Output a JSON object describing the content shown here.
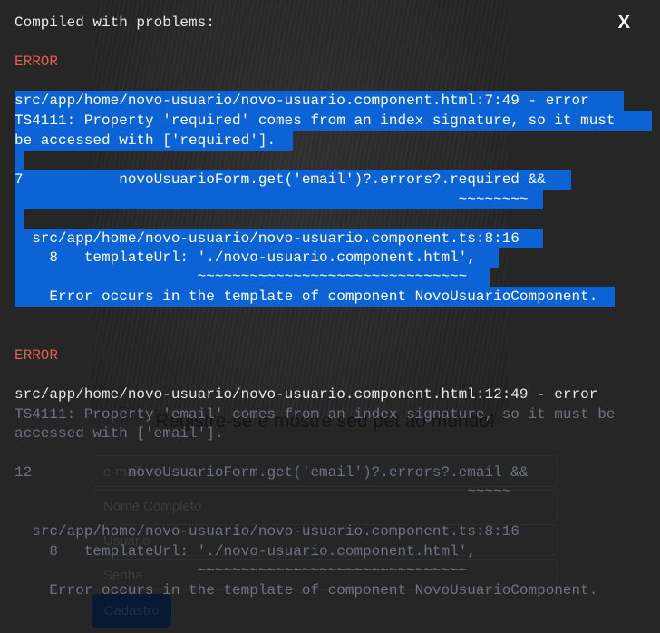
{
  "background_page": {
    "title": "Registre-se e mostre seu pet ao mundo!",
    "inputs": {
      "email": "e-mail",
      "full_name": "Nome Completo",
      "user": "Usuário",
      "password": "Senha"
    },
    "submit_label": "Cadastro"
  },
  "overlay": {
    "title": "Compiled with problems:",
    "close_label": "X",
    "errors": [
      {
        "label": "ERROR",
        "lines": [
          "src/app/home/novo-usuario/novo-usuario.component.html:7:49 - error",
          "TS4111: Property 'required' comes from an index signature, so it must",
          "be accessed with ['required'].",
          " ",
          "7           novoUsuarioForm.get('email')?.errors?.required &&",
          "                                                   ~~~~~~~~",
          " ",
          "  src/app/home/novo-usuario/novo-usuario.component.ts:8:16",
          "    8   templateUrl: './novo-usuario.component.html',",
          "                     ~~~~~~~~~~~~~~~~~~~~~~~~~~~~~~~",
          "    Error occurs in the template of component NovoUsuarioComponent."
        ]
      },
      {
        "label": "ERROR",
        "lines": [
          "src/app/home/novo-usuario/novo-usuario.component.html:12:49 - error",
          "TS4111: Property 'email' comes from an index signature, so it must be",
          "accessed with ['email'].",
          "12           novoUsuarioForm.get('email')?.errors?.email &&",
          "                                                    ~~~~~",
          "  src/app/home/novo-usuario/novo-usuario.component.ts:8:16",
          "    8   templateUrl: './novo-usuario.component.html',",
          "                     ~~~~~~~~~~~~~~~~~~~~~~~~~~~~~~~",
          "    Error occurs in the template of component NovoUsuarioComponent."
        ]
      }
    ]
  },
  "colors": {
    "selection": "#0b63d6",
    "error_label": "#e36049",
    "background": "#262626"
  }
}
